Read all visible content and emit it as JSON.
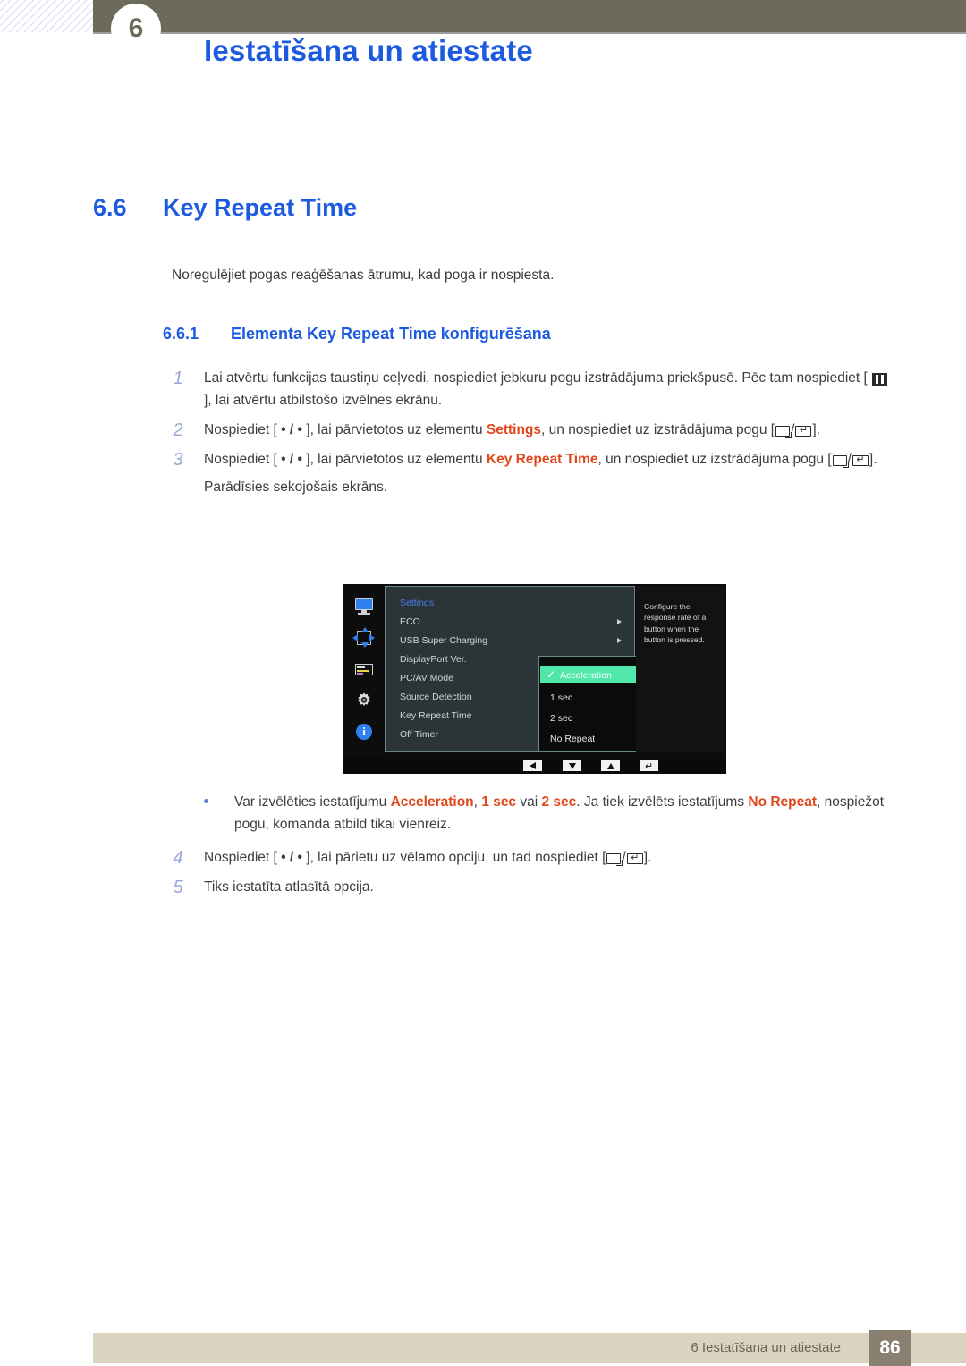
{
  "header": {
    "chapter_number": "6",
    "title": "Iestatīšana un atiestate"
  },
  "section": {
    "number": "6.6",
    "title": "Key Repeat Time",
    "intro": "Noregulējiet pogas reaģēšanas ātrumu, kad poga ir nospiesta."
  },
  "subsection": {
    "number": "6.6.1",
    "title": "Elementa Key Repeat Time konfigurēšana"
  },
  "steps": [
    {
      "num": "1",
      "parts": [
        {
          "t": "text",
          "v": "Lai atvērtu funkcijas taustiņu ceļvedi, nospiediet jebkuru pogu izstrādājuma priekšpusē. Pēc tam nospiediet [ "
        },
        {
          "t": "icon",
          "v": "menu-key-icon"
        },
        {
          "t": "text",
          "v": " ], lai atvērtu atbilstošo izvēlnes ekrānu."
        }
      ]
    },
    {
      "num": "2",
      "parts": [
        {
          "t": "text",
          "v": "Nospiediet [ "
        },
        {
          "t": "dots",
          "v": "• / •"
        },
        {
          "t": "text",
          "v": " ], lai pārvietotos uz elementu "
        },
        {
          "t": "hl",
          "v": "Settings"
        },
        {
          "t": "text",
          "v": ", un nospiediet uz izstrādājuma pogu ["
        },
        {
          "t": "icon",
          "v": "source-key-icon"
        },
        {
          "t": "text",
          "v": "/"
        },
        {
          "t": "icon",
          "v": "enter-key-icon"
        },
        {
          "t": "text",
          "v": "]."
        }
      ]
    },
    {
      "num": "3",
      "parts": [
        {
          "t": "text",
          "v": "Nospiediet [ "
        },
        {
          "t": "dots",
          "v": "• / •"
        },
        {
          "t": "text",
          "v": " ], lai pārvietotos uz elementu "
        },
        {
          "t": "hl",
          "v": "Key Repeat Time"
        },
        {
          "t": "text",
          "v": ", un nospiediet uz izstrādājuma pogu ["
        },
        {
          "t": "icon",
          "v": "source-key-icon"
        },
        {
          "t": "text",
          "v": "/"
        },
        {
          "t": "icon",
          "v": "enter-key-icon"
        },
        {
          "t": "text",
          "v": "]."
        }
      ],
      "note": "Parādīsies sekojošais ekrāns."
    }
  ],
  "bullet": {
    "parts": [
      {
        "t": "text",
        "v": "Var izvēlēties iestatījumu "
      },
      {
        "t": "hl",
        "v": "Acceleration"
      },
      {
        "t": "text",
        "v": ", "
      },
      {
        "t": "hl",
        "v": "1 sec"
      },
      {
        "t": "text",
        "v": " vai "
      },
      {
        "t": "hl",
        "v": "2 sec"
      },
      {
        "t": "text",
        "v": ". Ja tiek izvēlēts iestatījums "
      },
      {
        "t": "hl",
        "v": "No Repeat"
      },
      {
        "t": "text",
        "v": ", nospiežot pogu, komanda atbild tikai vienreiz."
      }
    ]
  },
  "steps_after": [
    {
      "num": "4",
      "parts": [
        {
          "t": "text",
          "v": "Nospiediet [ "
        },
        {
          "t": "dots",
          "v": "• / •"
        },
        {
          "t": "text",
          "v": " ], lai pārietu uz vēlamo opciju, un tad nospiediet ["
        },
        {
          "t": "icon",
          "v": "source-key-icon"
        },
        {
          "t": "text",
          "v": "/"
        },
        {
          "t": "icon",
          "v": "enter-key-icon"
        },
        {
          "t": "text",
          "v": "]."
        }
      ]
    },
    {
      "num": "5",
      "parts": [
        {
          "t": "text",
          "v": "Tiks iestatīta atlasītā opcija."
        }
      ]
    }
  ],
  "osd": {
    "icons": [
      "monitor-icon",
      "picture-position-icon",
      "osd-display-icon",
      "gear-icon",
      "info-icon"
    ],
    "menu": {
      "title": "Settings",
      "items": [
        {
          "label": "ECO",
          "has_arrow": true
        },
        {
          "label": "USB Super Charging",
          "has_arrow": true
        },
        {
          "label": "DisplayPort Ver.",
          "has_arrow": false
        },
        {
          "label": "PC/AV Mode",
          "has_arrow": false
        },
        {
          "label": "Source Detection",
          "has_arrow": false
        },
        {
          "label": "Key Repeat Time",
          "has_arrow": false
        },
        {
          "label": "Off Timer",
          "has_arrow": false
        }
      ]
    },
    "submenu": {
      "selected": "Acceleration",
      "options": [
        "1 sec",
        "2 sec",
        "No Repeat"
      ]
    },
    "tooltip": "Configure the response rate of a button when the button is pressed.",
    "bottom_buttons": [
      "left-arrow-button",
      "down-arrow-button",
      "up-arrow-button",
      "enter-button"
    ],
    "colors": {
      "highlight": "#4fe8aa",
      "menu_bg": "#2b3436",
      "title_blue": "#4a7cf0"
    }
  },
  "footer": {
    "text": "6 Iestatīšana un atiestate",
    "page": "86"
  },
  "theme": {
    "accent_blue": "#1c5ae0",
    "highlight_red": "#e2471c",
    "header_olive": "#6c6a58",
    "footer_beige": "#d8d4c0"
  }
}
